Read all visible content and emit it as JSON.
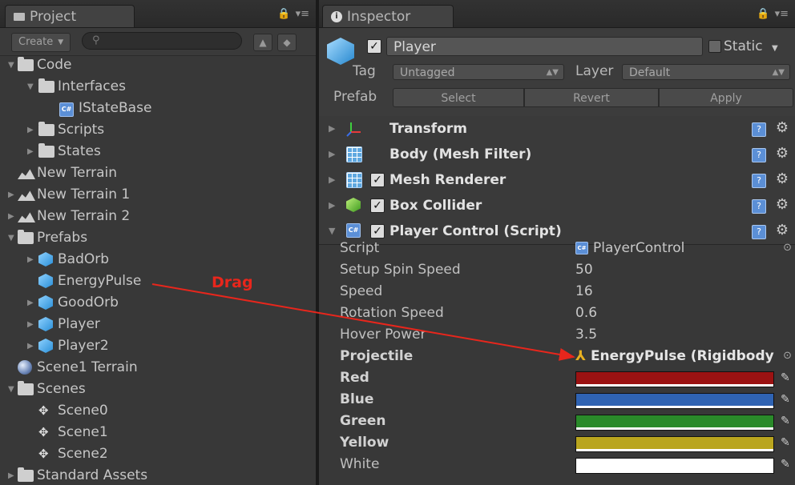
{
  "project": {
    "tab_label": "Project",
    "create_label": "Create",
    "tree": [
      {
        "label": "Code",
        "icon": "folder",
        "depth": 0,
        "arrow": "open"
      },
      {
        "label": "Interfaces",
        "icon": "folder",
        "depth": 1,
        "arrow": "open"
      },
      {
        "label": "IStateBase",
        "icon": "csharp",
        "depth": 2,
        "arrow": "none"
      },
      {
        "label": "Scripts",
        "icon": "folder",
        "depth": 1,
        "arrow": "closed"
      },
      {
        "label": "States",
        "icon": "folder",
        "depth": 1,
        "arrow": "closed"
      },
      {
        "label": "New Terrain",
        "icon": "terrain",
        "depth": 0,
        "arrow": "none"
      },
      {
        "label": "New Terrain 1",
        "icon": "terrain",
        "depth": 0,
        "arrow": "closed"
      },
      {
        "label": "New Terrain 2",
        "icon": "terrain",
        "depth": 0,
        "arrow": "closed"
      },
      {
        "label": "Prefabs",
        "icon": "folder",
        "depth": 0,
        "arrow": "open"
      },
      {
        "label": "BadOrb",
        "icon": "cube",
        "depth": 1,
        "arrow": "closed"
      },
      {
        "label": "EnergyPulse",
        "icon": "cube",
        "depth": 1,
        "arrow": "none"
      },
      {
        "label": "GoodOrb",
        "icon": "cube",
        "depth": 1,
        "arrow": "closed"
      },
      {
        "label": "Player",
        "icon": "cube",
        "depth": 1,
        "arrow": "closed"
      },
      {
        "label": "Player2",
        "icon": "cube",
        "depth": 1,
        "arrow": "closed"
      },
      {
        "label": "Scene1 Terrain",
        "icon": "sphere",
        "depth": 0,
        "arrow": "none"
      },
      {
        "label": "Scenes",
        "icon": "folder",
        "depth": 0,
        "arrow": "open"
      },
      {
        "label": "Scene0",
        "icon": "unity",
        "depth": 1,
        "arrow": "none"
      },
      {
        "label": "Scene1",
        "icon": "unity",
        "depth": 1,
        "arrow": "none"
      },
      {
        "label": "Scene2",
        "icon": "unity",
        "depth": 1,
        "arrow": "none"
      },
      {
        "label": "Standard Assets",
        "icon": "folder",
        "depth": 0,
        "arrow": "closed"
      }
    ]
  },
  "inspector": {
    "tab_label": "Inspector",
    "object_name": "Player",
    "static_label": "Static",
    "tag_label": "Tag",
    "tag_value": "Untagged",
    "layer_label": "Layer",
    "layer_value": "Default",
    "prefab_label": "Prefab",
    "prefab_buttons": [
      "Select",
      "Revert",
      "Apply"
    ],
    "components": [
      {
        "title": "Transform",
        "icon": "transform-icon",
        "checkbox": false
      },
      {
        "title": "Body (Mesh Filter)",
        "icon": "mesh-filter-icon",
        "checkbox": false
      },
      {
        "title": "Mesh Renderer",
        "icon": "mesh-renderer-icon",
        "checkbox": true
      },
      {
        "title": "Box Collider",
        "icon": "box-collider-icon",
        "checkbox": true
      },
      {
        "title": "Player Control (Script)",
        "icon": "script-icon",
        "checkbox": true
      }
    ],
    "properties": [
      {
        "label": "Script",
        "value": "PlayerControl",
        "kind": "script",
        "bold": false
      },
      {
        "label": "Setup Spin Speed",
        "value": "50",
        "kind": "text",
        "bold": false
      },
      {
        "label": "Speed",
        "value": "16",
        "kind": "text",
        "bold": false
      },
      {
        "label": "Rotation Speed",
        "value": "0.6",
        "kind": "text",
        "bold": false
      },
      {
        "label": "Hover Power",
        "value": "3.5",
        "kind": "text",
        "bold": false
      },
      {
        "label": "Projectile",
        "value": "EnergyPulse (Rigidbody",
        "kind": "object",
        "bold": true
      },
      {
        "label": "Red",
        "value": "",
        "kind": "color",
        "color": "#9b1212",
        "bold": true
      },
      {
        "label": "Blue",
        "value": "",
        "kind": "color",
        "color": "#2f63b3",
        "bold": true
      },
      {
        "label": "Green",
        "value": "",
        "kind": "color",
        "color": "#2a8a2a",
        "bold": true
      },
      {
        "label": "Yellow",
        "value": "",
        "kind": "color",
        "color": "#b9a51e",
        "bold": true
      },
      {
        "label": "White",
        "value": "",
        "kind": "color",
        "color": "#ffffff",
        "bold": false
      }
    ]
  },
  "annotation": {
    "drag_label": "Drag",
    "color": "#e8261c"
  }
}
